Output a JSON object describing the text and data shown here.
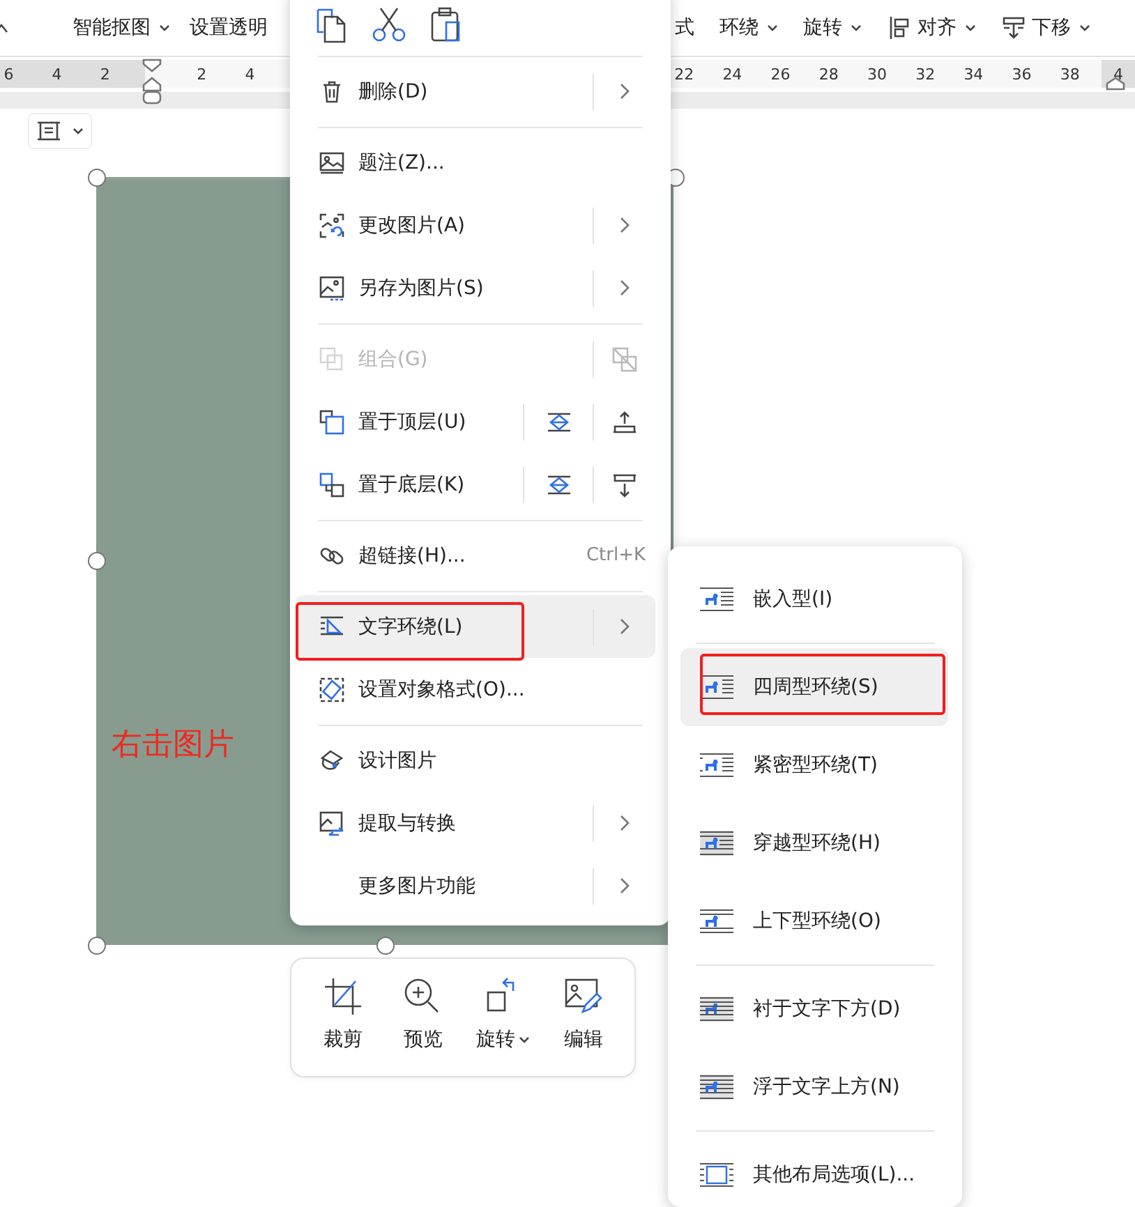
{
  "ribbon": {
    "left_items": [
      {
        "label": "智能抠图",
        "dropdown": true
      },
      {
        "label": "设置透明",
        "dropdown": false
      }
    ],
    "right_items": [
      {
        "label": "式",
        "dropdown": false,
        "kind": "text"
      },
      {
        "label": "环绕",
        "dropdown": true,
        "kind": "text"
      },
      {
        "label": "旋转",
        "dropdown": true,
        "kind": "text"
      },
      {
        "label": "对齐",
        "dropdown": true,
        "kind": "align"
      },
      {
        "label": "下移",
        "dropdown": true,
        "kind": "down"
      }
    ]
  },
  "ruler": {
    "left_ticks": [
      "6",
      "4",
      "2"
    ],
    "right_ticks": [
      "2",
      "4"
    ],
    "far_ticks": [
      "22",
      "24",
      "26",
      "28",
      "30",
      "32",
      "34",
      "36",
      "38",
      "4"
    ]
  },
  "document": {
    "annotation": "右击图片",
    "picture": {
      "kind": "picture",
      "selected": true
    }
  },
  "context_menu": {
    "groups": [
      [
        {
          "label": "删除(D)",
          "kind": "plain",
          "submenu": true,
          "disabled": false,
          "hovered": false,
          "marked": false
        }
      ],
      [
        {
          "label": "题注(Z)...",
          "kind": "plain",
          "submenu": false,
          "disabled": false,
          "hovered": false,
          "marked": false
        },
        {
          "label": "更改图片(A)",
          "kind": "plain",
          "submenu": true,
          "disabled": false,
          "hovered": false,
          "marked": false
        },
        {
          "label": "另存为图片(S)",
          "kind": "plain",
          "submenu": true,
          "disabled": false,
          "hovered": false,
          "marked": false
        }
      ],
      [
        {
          "label": "组合(G)",
          "kind": "group",
          "disabled": true,
          "hovered": false,
          "marked": false
        },
        {
          "label": "置于顶层(U)",
          "kind": "front",
          "disabled": false,
          "hovered": false,
          "marked": false
        },
        {
          "label": "置于底层(K)",
          "kind": "back",
          "disabled": false,
          "hovered": false,
          "marked": false
        }
      ],
      [
        {
          "label": "超链接(H)...",
          "kind": "plain",
          "submenu": false,
          "disabled": false,
          "hovered": false,
          "marked": false,
          "shortcut": "Ctrl+K"
        }
      ],
      [
        {
          "label": "文字环绕(L)",
          "kind": "plain",
          "submenu": true,
          "disabled": false,
          "hovered": true,
          "marked": true
        },
        {
          "label": "设置对象格式(O)...",
          "kind": "plain",
          "submenu": false,
          "disabled": false,
          "hovered": false,
          "marked": false
        }
      ],
      [
        {
          "label": "设计图片",
          "kind": "plain",
          "submenu": false,
          "disabled": false,
          "hovered": false,
          "marked": false
        },
        {
          "label": "提取与转换",
          "kind": "plain",
          "submenu": true,
          "disabled": false,
          "hovered": false,
          "marked": false
        },
        {
          "label": "更多图片功能",
          "kind": "plain",
          "submenu": true,
          "disabled": false,
          "hovered": false,
          "marked": false
        }
      ]
    ]
  },
  "wrap_menu": {
    "groups": [
      [
        {
          "label": "嵌入型(I)",
          "hovered": false,
          "marked": false
        }
      ],
      [
        {
          "label": "四周型环绕(S)",
          "hovered": true,
          "marked": true
        },
        {
          "label": "紧密型环绕(T)",
          "hovered": false,
          "marked": false
        },
        {
          "label": "穿越型环绕(H)",
          "hovered": false,
          "marked": false
        },
        {
          "label": "上下型环绕(O)",
          "hovered": false,
          "marked": false
        }
      ],
      [
        {
          "label": "衬于文字下方(D)",
          "hovered": false,
          "marked": false
        },
        {
          "label": "浮于文字上方(N)",
          "hovered": false,
          "marked": false
        }
      ],
      [
        {
          "label": "其他布局选项(L)...",
          "hovered": false,
          "marked": false
        }
      ]
    ]
  },
  "picture_toolbar": [
    {
      "label": "裁剪",
      "dropdown": false
    },
    {
      "label": "预览",
      "dropdown": false
    },
    {
      "label": "旋转",
      "dropdown": true
    },
    {
      "label": "编辑",
      "dropdown": false
    }
  ]
}
